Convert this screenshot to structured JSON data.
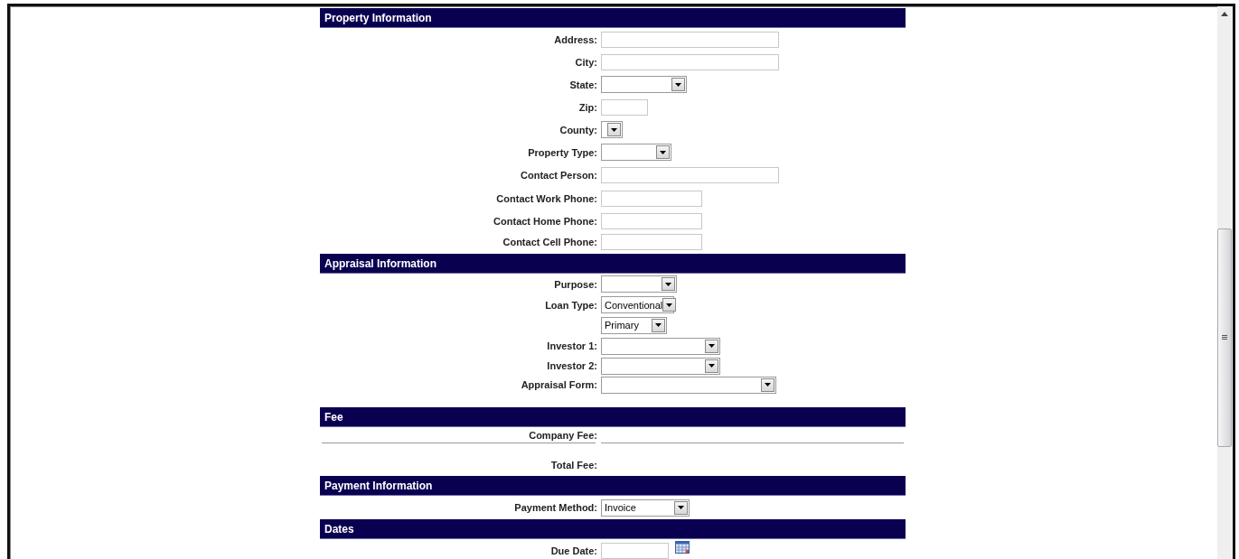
{
  "sections": [
    {
      "title": "Property Information",
      "rows": [
        {
          "label": "Address:",
          "kind": "text"
        },
        {
          "label": "City:",
          "kind": "text"
        },
        {
          "label": "State:",
          "kind": "select"
        },
        {
          "label": "Zip:",
          "kind": "text"
        },
        {
          "label": "County:",
          "kind": "select"
        },
        {
          "label": "Property Type:",
          "kind": "select"
        },
        {
          "label": "Contact Person:",
          "kind": "text"
        },
        {
          "label": "Contact Work Phone:",
          "kind": "text"
        },
        {
          "label": "Contact Home Phone:",
          "kind": "text"
        },
        {
          "label": "Contact Cell Phone:",
          "kind": "text"
        }
      ]
    },
    {
      "title": "Appraisal Information",
      "rows": [
        {
          "label": "Purpose:",
          "kind": "select"
        },
        {
          "label": "Loan Type:",
          "kind": "select",
          "value": "Conventional"
        },
        {
          "kind": "select",
          "value": "Primary"
        },
        {
          "label": "Investor 1:",
          "kind": "select"
        },
        {
          "label": "Investor 2:",
          "kind": "select"
        },
        {
          "label": "Appraisal Form:",
          "kind": "select"
        }
      ]
    },
    {
      "title": "Fee",
      "rows": [
        {
          "label": "Company Fee:",
          "kind": "static"
        },
        {
          "label": "Total Fee:",
          "kind": "static"
        }
      ]
    },
    {
      "title": "Payment Information",
      "rows": [
        {
          "label": "Payment Method:",
          "kind": "select",
          "value": "Invoice"
        }
      ]
    },
    {
      "title": "Dates",
      "rows": [
        {
          "label": "Due Date:",
          "kind": "date"
        }
      ]
    }
  ]
}
